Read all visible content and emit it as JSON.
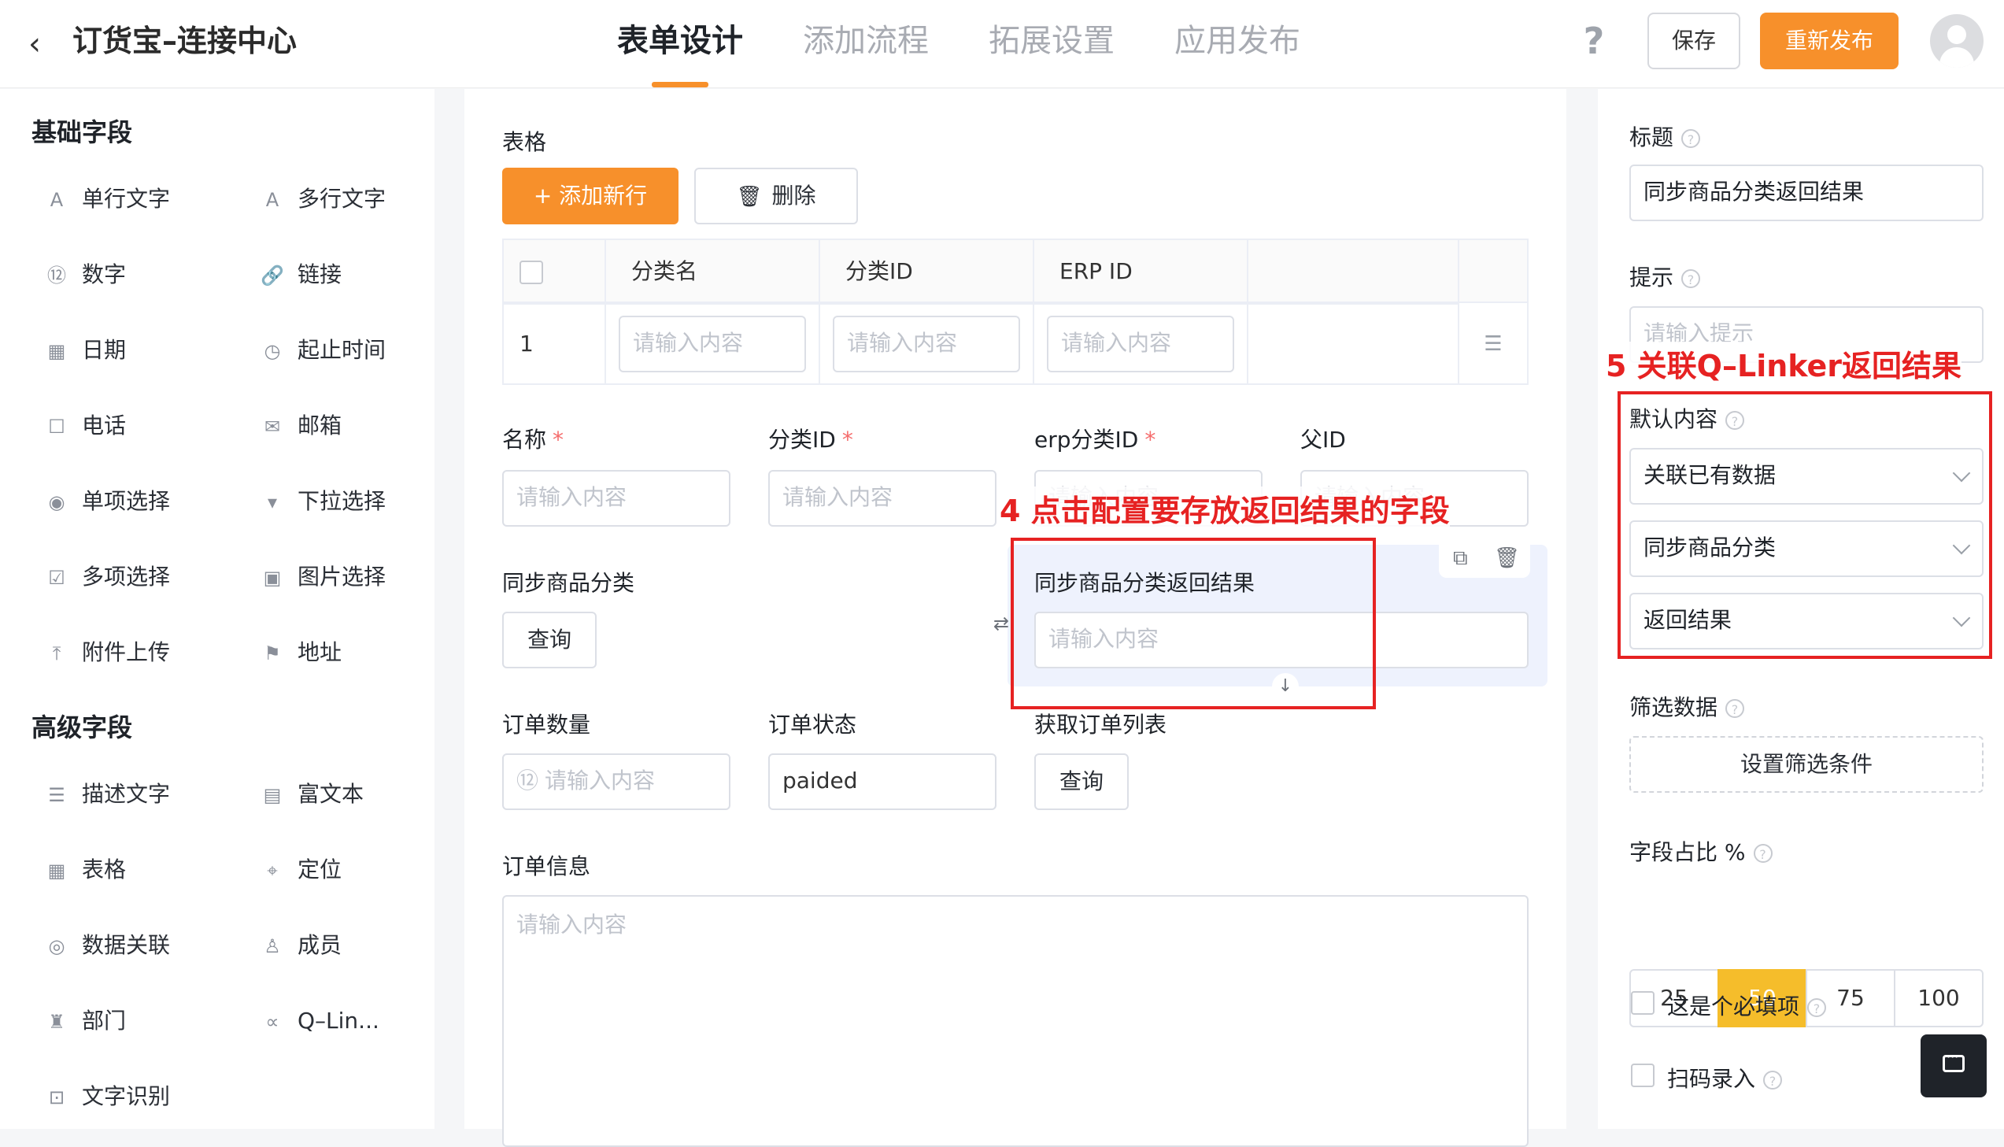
{
  "header": {
    "back_glyph": "‹",
    "title": "订货宝–连接中心",
    "tabs": [
      "表单设计",
      "添加流程",
      "拓展设置",
      "应用发布"
    ],
    "active_tab": 0,
    "help_glyph": "?",
    "save_label": "保存",
    "republish_label": "重新发布"
  },
  "left_panel": {
    "basic_title": "基础字段",
    "basic_fields": [
      {
        "label": "单行文字",
        "icon": "single-line-text-icon",
        "glyph": "A"
      },
      {
        "label": "多行文字",
        "icon": "multi-line-text-icon",
        "glyph": "A"
      },
      {
        "label": "数字",
        "icon": "number-icon",
        "glyph": "⑫"
      },
      {
        "label": "链接",
        "icon": "link-icon",
        "glyph": "🔗"
      },
      {
        "label": "日期",
        "icon": "calendar-icon",
        "glyph": "▦"
      },
      {
        "label": "起止时间",
        "icon": "date-range-icon",
        "glyph": "◷"
      },
      {
        "label": "电话",
        "icon": "phone-icon",
        "glyph": "☐"
      },
      {
        "label": "邮箱",
        "icon": "mail-icon",
        "glyph": "✉"
      },
      {
        "label": "单项选择",
        "icon": "radio-icon",
        "glyph": "◉"
      },
      {
        "label": "下拉选择",
        "icon": "dropdown-icon",
        "glyph": "▾"
      },
      {
        "label": "多项选择",
        "icon": "checkbox-icon",
        "glyph": "☑"
      },
      {
        "label": "图片选择",
        "icon": "image-icon",
        "glyph": "▣"
      },
      {
        "label": "附件上传",
        "icon": "upload-icon",
        "glyph": "⤒"
      },
      {
        "label": "地址",
        "icon": "signpost-icon",
        "glyph": "⚑"
      }
    ],
    "advanced_title": "高级字段",
    "advanced_fields": [
      {
        "label": "描述文字",
        "icon": "description-icon",
        "glyph": "☰"
      },
      {
        "label": "富文本",
        "icon": "rich-text-icon",
        "glyph": "▤"
      },
      {
        "label": "表格",
        "icon": "table-icon",
        "glyph": "▦"
      },
      {
        "label": "定位",
        "icon": "location-icon",
        "glyph": "⌖"
      },
      {
        "label": "数据关联",
        "icon": "data-link-icon",
        "glyph": "◎"
      },
      {
        "label": "成员",
        "icon": "user-icon",
        "glyph": "♙"
      },
      {
        "label": "部门",
        "icon": "org-chart-icon",
        "glyph": "♜"
      },
      {
        "label": "Q–Lin...",
        "icon": "share-nodes-icon",
        "glyph": "∝"
      },
      {
        "label": "文字识别",
        "icon": "scan-icon",
        "glyph": "⊡"
      }
    ]
  },
  "canvas": {
    "table_label": "表格",
    "add_row_label": "+ 添加新行",
    "delete_label": "删除",
    "table_headers": [
      "分类名",
      "分类ID",
      "ERP ID"
    ],
    "row_index": "1",
    "input_placeholder": "请输入内容",
    "name_label": "名称",
    "category_id_label": "分类ID",
    "erp_category_id_label": "erp分类ID",
    "parent_id_label": "父ID",
    "required_mark": "*",
    "sync_category_label": "同步商品分类",
    "query_label": "查询",
    "sync_result_label": "同步商品分类返回结果",
    "order_qty_label": "订单数量",
    "order_status_label": "订单状态",
    "order_status_value": "paided",
    "get_order_list_label": "获取订单列表",
    "order_info_label": "订单信息",
    "number_prefix": "⑫"
  },
  "right_panel": {
    "title_label": "标题",
    "title_value": "同步商品分类返回结果",
    "hint_label": "提示",
    "hint_placeholder": "请输入提示",
    "default_label": "默认内容",
    "default_selects": [
      "关联已有数据",
      "同步商品分类",
      "返回结果"
    ],
    "filter_label": "筛选数据",
    "filter_button": "设置筛选条件",
    "ratio_label": "字段占比 %",
    "ratio_options": [
      "25",
      "50",
      "75",
      "100"
    ],
    "ratio_selected": "50",
    "required_label": "这是个必填项",
    "scan_label": "扫码录入"
  },
  "annotations": {
    "step4": "4 点击配置要存放返回结果的字段",
    "step5": "5 关联Q–Linker返回结果"
  },
  "colors": {
    "accent": "#f7902b",
    "ratio_active": "#f5bd2b",
    "annotation": "#e62222",
    "selected_bg": "#eef2fd"
  }
}
